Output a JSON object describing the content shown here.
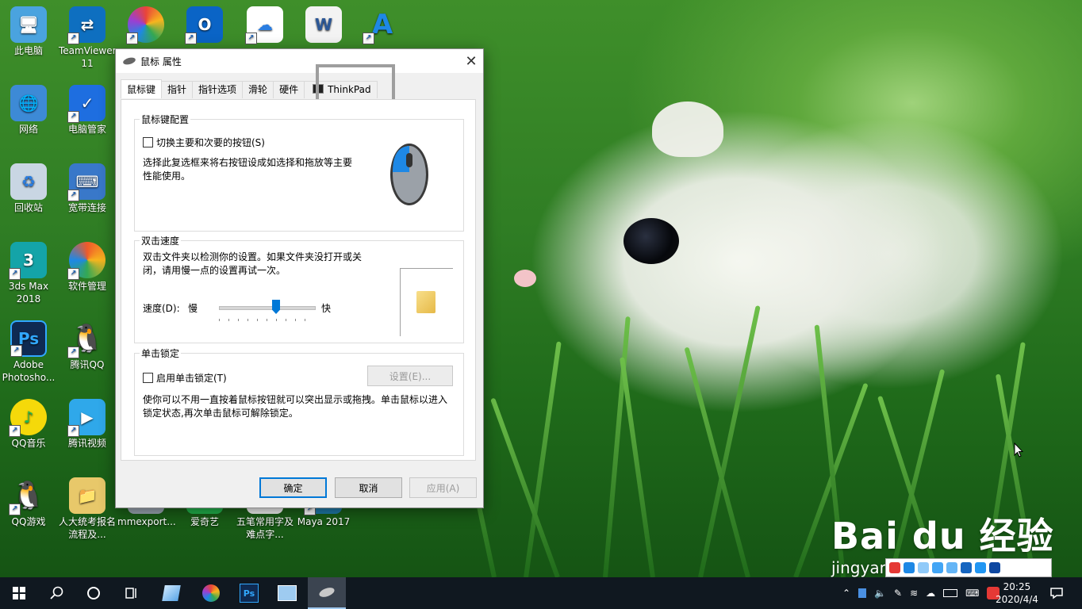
{
  "desktop": {
    "icons": [
      {
        "label": "此电脑",
        "color": "#4aa3df",
        "glyph": "🖥"
      },
      {
        "label": "TeamViewer 11",
        "color": "#0e6fc0",
        "glyph": "⇄"
      },
      {
        "label": "",
        "color": "#e9443a",
        "glyph": "◉"
      },
      {
        "label": "",
        "color": "#0a64c6",
        "glyph": "O"
      },
      {
        "label": "",
        "color": "#ffffff",
        "glyph": "☁"
      },
      {
        "label": "",
        "color": "#2b5797",
        "glyph": "W"
      },
      {
        "label": "",
        "color": "#1e88e5",
        "glyph": "A"
      },
      {
        "label": "网络",
        "color": "#3d8ad6",
        "glyph": "🌐"
      },
      {
        "label": "电脑管家",
        "color": "#1e6ee0",
        "glyph": "✓"
      },
      {
        "label": "回收站",
        "color": "#c9d6e3",
        "glyph": "♻"
      },
      {
        "label": "宽带连接",
        "color": "#3978c9",
        "glyph": "⌨"
      },
      {
        "label": "3ds Max 2018",
        "color": "#14a4a8",
        "glyph": "3"
      },
      {
        "label": "软件管理",
        "color": "#ef5a2a",
        "glyph": "✿"
      },
      {
        "label": "Adobe Photosho...",
        "color": "#0f2a52",
        "glyph": "Ps"
      },
      {
        "label": "腾讯QQ",
        "color": "#111111",
        "glyph": "🐧"
      },
      {
        "label": "QQ音乐",
        "color": "#f5d90a",
        "glyph": "♪"
      },
      {
        "label": "腾讯视频",
        "color": "#2fa8ea",
        "glyph": "▶"
      },
      {
        "label": "QQ游戏",
        "color": "#f0f0f0",
        "glyph": "🐧"
      },
      {
        "label": "人大统考报名流程及...",
        "color": "#e8c86a",
        "glyph": "📁"
      },
      {
        "label": "mmexport...",
        "color": "#9aa5b1",
        "glyph": "▦"
      },
      {
        "label": "爱奇艺",
        "color": "#21b24b",
        "glyph": "▣"
      },
      {
        "label": "五笔常用字及难点字...",
        "color": "#f2f2f2",
        "glyph": "▤"
      },
      {
        "label": "Maya 2017",
        "color": "#1f7aa8",
        "glyph": "M"
      }
    ]
  },
  "dialog": {
    "title": "鼠标 属性",
    "close_label": "✕",
    "tabs": [
      "鼠标键",
      "指针",
      "指针选项",
      "滑轮",
      "硬件",
      "ThinkPad"
    ],
    "button_config": {
      "group_title": "鼠标键配置",
      "swap_checkbox_label": "切换主要和次要的按钮(S)",
      "swap_checked": false,
      "description": "选择此复选框来将右按钮设成如选择和拖放等主要性能使用。"
    },
    "double_click": {
      "group_title": "双击速度",
      "description": "双击文件夹以检测你的设置。如果文件夹没打开或关闭，请用慢一点的设置再试一次。",
      "speed_label": "速度(D):",
      "slow_label": "慢",
      "fast_label": "快",
      "speed_value": 0.6
    },
    "click_lock": {
      "group_title": "单击锁定",
      "enable_label": "启用单击锁定(T)",
      "enable_checked": false,
      "settings_button": "设置(E)...",
      "description": "使你可以不用一直按着鼠标按钮就可以突出显示或拖拽。单击鼠标以进入锁定状态,再次单击鼠标可解除锁定。"
    },
    "buttons": {
      "ok": "确定",
      "cancel": "取消",
      "apply": "应用(A)"
    }
  },
  "taskbar": {
    "clock_time": "20:25",
    "clock_date": "2020/4/4",
    "pinned": [
      "start-icon",
      "search-icon",
      "cortana-icon",
      "task-view-icon",
      "notepad-icon",
      "browser-icon",
      "photoshop-icon",
      "image-viewer-icon",
      "mouse-icon"
    ]
  },
  "watermark": {
    "brand": "Bai du 经验",
    "url": "jingyan.baidu.com"
  }
}
